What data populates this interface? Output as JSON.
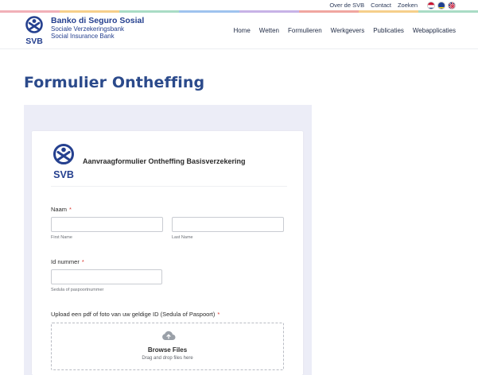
{
  "topbar": {
    "links": [
      "Over de SVB",
      "Contact",
      "Zoeken"
    ],
    "flags": [
      "flag-aruba-curacao",
      "flag-curacao",
      "flag-uk"
    ]
  },
  "brand": {
    "name": "Banko di Seguro Sosial",
    "line2": "Sociale Verzekeringsbank",
    "line3": "Social Insurance Bank",
    "logo_text": "SVB"
  },
  "nav": {
    "items": [
      "Home",
      "Wetten",
      "Formulieren",
      "Werkgevers",
      "Publicaties",
      "Webapplicaties"
    ]
  },
  "page": {
    "title": "Formulier Ontheffing"
  },
  "form": {
    "logo_text": "SVB",
    "title": "Aanvraagformulier Ontheffing Basisverzekering",
    "naam_label": "Naam",
    "first_name_sub": "First Name",
    "last_name_sub": "Last Name",
    "id_label": "Id nummer",
    "id_sub": "Sedula of paspoortnummer",
    "upload_label": "Upload een pdf of foto van uw geldige ID (Sedula of Paspoort)",
    "required_mark": "*",
    "browse": "Browse Files",
    "drag_drop": "Drag and drop files here"
  },
  "colors": {
    "brand_blue": "#25408f",
    "title_blue": "#2b4a8b",
    "required_red": "#d9342b",
    "form_bg": "#ecedf7",
    "stripe": [
      "#f1b0b8",
      "#f6cf8a",
      "#a9dcc5",
      "#9fc3ee",
      "#c7b2e6",
      "#f0a6a0",
      "#f6cf8a",
      "#a9dcc5"
    ]
  }
}
